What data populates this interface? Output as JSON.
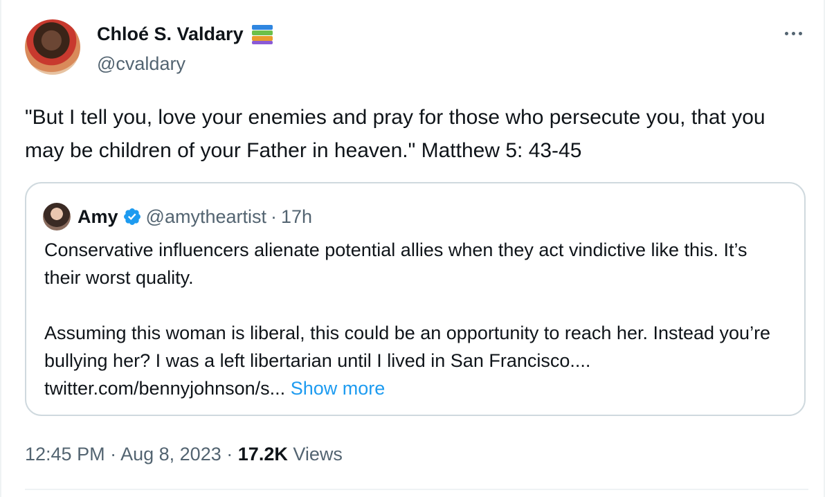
{
  "tweet": {
    "author_name": "Chloé S. Valdary",
    "author_emoji": "books-emoji",
    "author_handle": "@cvaldary",
    "text": "\"But I tell you, love your enemies and pray for those who persecute you, that you may be children of your Father in heaven.\" Matthew 5: 43-45",
    "time": "12:45 PM",
    "date": "Aug 8, 2023",
    "views_count": "17.2K",
    "views_label": "Views",
    "separator": "·"
  },
  "quoted": {
    "author_name": "Amy",
    "verified": true,
    "verified_color": "#1d9bf0",
    "author_handle": "@amytheartist",
    "separator": "·",
    "time": "17h",
    "paragraph_1": "Conservative influencers alienate potential allies when they act vindictive like this. It’s their worst quality.",
    "paragraph_2": "Assuming this woman is liberal, this could be an opportunity to reach her. Instead you’re bullying her? I was a left libertarian until I lived in San Francisco.... twitter.com/bennyjohnson/s...",
    "show_more": "Show more"
  },
  "colors": {
    "text_primary": "#0f1419",
    "text_secondary": "#536471",
    "link": "#1d9bf0",
    "border": "#cfd9de"
  },
  "icons": {
    "more": "more-horizontal-icon",
    "verified": "verified-badge-icon"
  }
}
